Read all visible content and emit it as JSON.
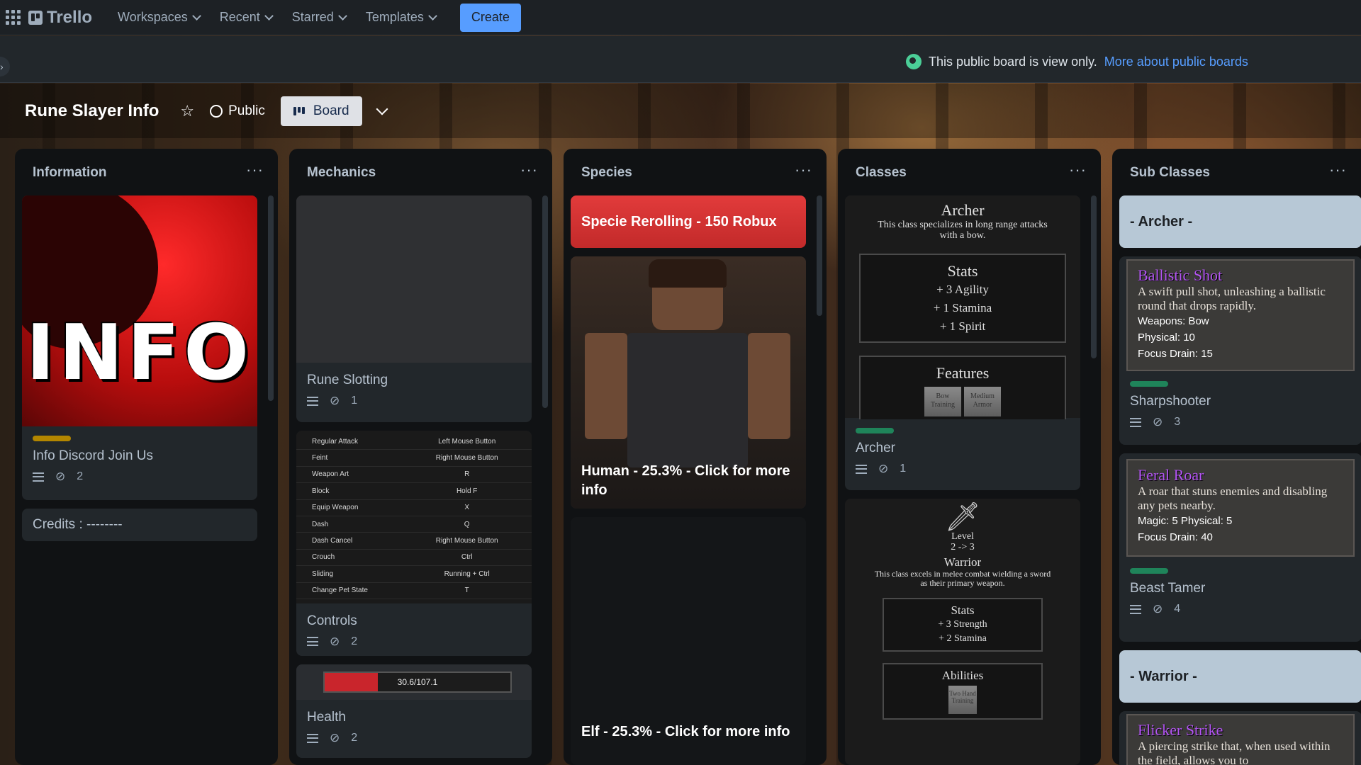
{
  "nav": {
    "app_name": "Trello",
    "items": [
      "Workspaces",
      "Recent",
      "Starred",
      "Templates"
    ],
    "create_label": "Create"
  },
  "banner": {
    "message": "This public board is view only.",
    "link": "More about public boards"
  },
  "board": {
    "title": "Rune Slayer Info",
    "visibility": "Public",
    "view": "Board"
  },
  "colors": {
    "accent": "#579dff",
    "list_bg": "#101214",
    "card_bg": "#22272b",
    "label_yellow": "#b38600",
    "label_green": "#1f845a",
    "species_red": "#e23b3b",
    "subclass_header": "#b7c8d6",
    "ability_purple": "#b455f4"
  },
  "lists": {
    "information": {
      "title": "Information",
      "cards": [
        {
          "cover_text": "INFO",
          "title": "Info Discord Join Us",
          "attachments": "2"
        },
        {
          "title": "Credits : --------"
        }
      ]
    },
    "mechanics": {
      "title": "Mechanics",
      "cards": [
        {
          "title": "Rune Slotting",
          "attachments": "1"
        },
        {
          "title": "Controls",
          "attachments": "2"
        },
        {
          "title": "Health",
          "attachments": "2",
          "health_text": "30.6/107.1"
        }
      ],
      "controls_table": [
        [
          "Regular Attack",
          "Left Mouse Button"
        ],
        [
          "Feint",
          "Right Mouse Button"
        ],
        [
          "Weapon Art",
          "R"
        ],
        [
          "Block",
          "Hold F"
        ],
        [
          "Equip Weapon",
          "X"
        ],
        [
          "Dash",
          "Q"
        ],
        [
          "Dash Cancel",
          "Right Mouse Button"
        ],
        [
          "Crouch",
          "Ctrl"
        ],
        [
          "Sliding",
          "Running + Ctrl"
        ],
        [
          "Change Pet State",
          "T"
        ]
      ]
    },
    "species": {
      "title": "Species",
      "cards": [
        {
          "title": "Specie Rerolling - 150 Robux"
        },
        {
          "title": "Human - 25.3% - Click for more info"
        },
        {
          "title": "Elf - 25.3% - Click for more info"
        }
      ]
    },
    "classes": {
      "title": "Classes",
      "archer": {
        "heading": "Archer",
        "desc": "This class specializes in long range attacks with a bow.",
        "stats_title": "Stats",
        "stats": [
          "+ 3 Agility",
          "+ 1 Stamina",
          "+ 1 Spirit"
        ],
        "features_title": "Features",
        "features": [
          "Bow Training",
          "Medium Armor"
        ],
        "card_title": "Archer",
        "attachments": "1"
      },
      "warrior": {
        "level_label": "Level",
        "level_value": "2 -> 3",
        "heading": "Warrior",
        "desc": "This class excels in melee combat wielding a sword as their primary weapon.",
        "stats_title": "Stats",
        "stats": [
          "+ 3 Strength",
          "+ 2 Stamina"
        ],
        "abilities_title": "Abilities",
        "abilities": [
          "Two Hand Training"
        ]
      }
    },
    "subclasses": {
      "title": "Sub Classes",
      "archer_header": "- Archer -",
      "warrior_header": "- Warrior -",
      "cards": [
        {
          "ability": "Ballistic Shot",
          "desc": "A swift pull shot, unleashing a ballistic round that drops rapidly.",
          "lines": [
            "Weapons: Bow",
            "Physical: 10",
            "Focus Drain: 15"
          ],
          "title": "Sharpshooter",
          "attachments": "3"
        },
        {
          "ability": "Feral Roar",
          "desc": "A roar that stuns enemies and disabling any pets nearby.",
          "lines": [
            "Magic: 5 Physical: 5",
            "Focus Drain: 40"
          ],
          "title": "Beast Tamer",
          "attachments": "4"
        },
        {
          "ability": "Flicker Strike",
          "desc": "A piercing strike that, when used within the field, allows you to"
        }
      ]
    }
  }
}
